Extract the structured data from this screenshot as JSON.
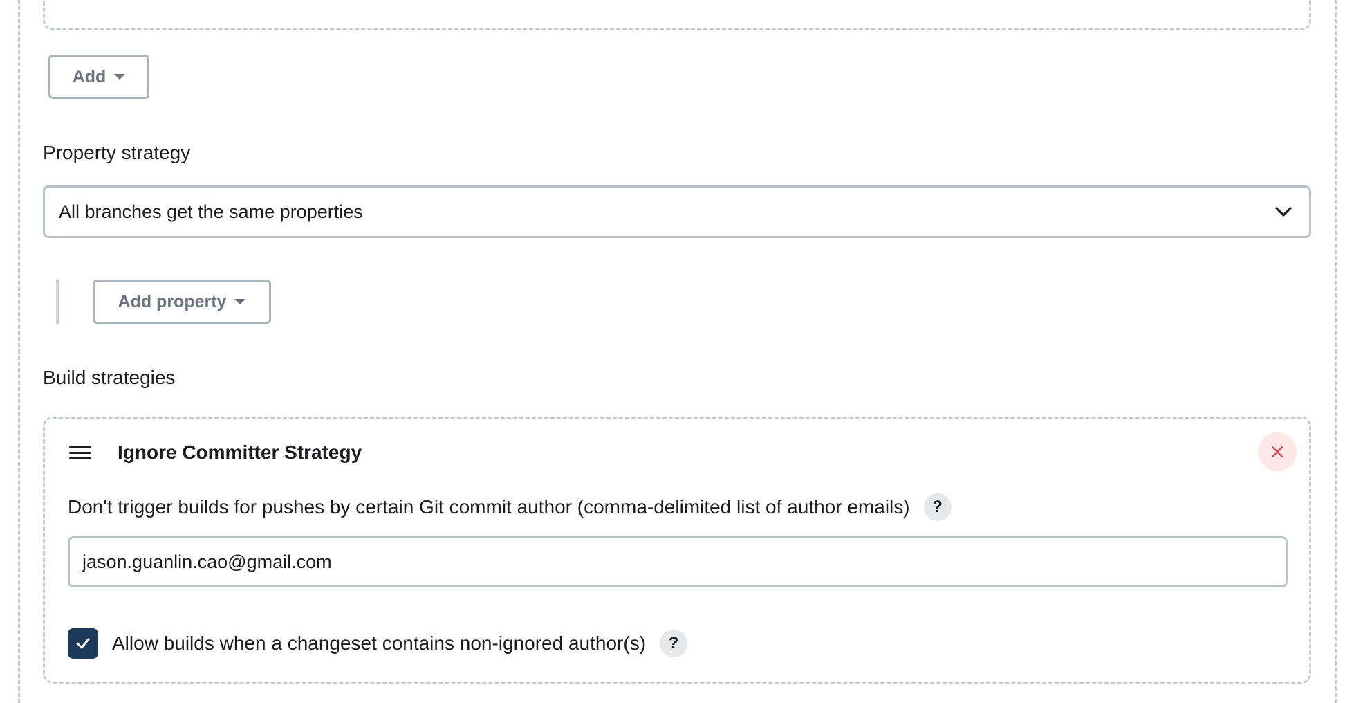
{
  "top_section": {
    "add_button_label": "Add"
  },
  "property_strategy": {
    "label": "Property strategy",
    "selected_value": "All branches get the same properties",
    "add_property_label": "Add property"
  },
  "build_strategies": {
    "label": "Build strategies",
    "strategy": {
      "title": "Ignore Committer Strategy",
      "field_label": "Don't trigger builds for pushes by certain Git commit author (comma-delimited list of author emails)",
      "field_value": "jason.guanlin.cao@gmail.com",
      "checkbox_label": "Allow builds when a changeset contains non-ignored author(s)",
      "checkbox_checked": true,
      "help_glyph": "?"
    }
  },
  "icons": {
    "caret": "caret-down-icon",
    "chevron": "chevron-down-icon",
    "drag": "drag-handle-icon",
    "close": "close-icon",
    "check": "checkmark-icon"
  },
  "colors": {
    "border": "#b9c3c8",
    "dashed_border": "#c3cbd0",
    "button_text": "#6f7280",
    "checkbox_fill": "#1c3a5a",
    "close_bg": "#fde8e8",
    "close_icon": "#e53935",
    "help_bg": "#e7e8ea"
  }
}
